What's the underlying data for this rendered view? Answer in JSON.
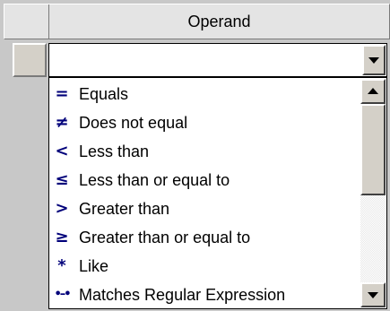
{
  "grid": {
    "column_header": "Operand"
  },
  "combo": {
    "value": ""
  },
  "dropdown": {
    "items": [
      {
        "icon": "=",
        "icon_name": "equals-icon",
        "label": "Equals"
      },
      {
        "icon": "≠",
        "icon_name": "not-equal-icon",
        "label": "Does not equal"
      },
      {
        "icon": "<",
        "icon_name": "less-than-icon",
        "label": "Less than"
      },
      {
        "icon": "≤",
        "icon_name": "less-than-or-equal-icon",
        "label": "Less than or equal to"
      },
      {
        "icon": ">",
        "icon_name": "greater-than-icon",
        "label": "Greater than"
      },
      {
        "icon": "≥",
        "icon_name": "greater-than-or-equal-icon",
        "label": "Greater than or equal to"
      },
      {
        "icon": "*",
        "icon_name": "asterisk-icon",
        "label": "Like"
      },
      {
        "icon": "•–•",
        "icon_name": "regex-icon",
        "label": "Matches Regular Expression"
      }
    ]
  },
  "colors": {
    "icon_color": "#00007a",
    "face": "#d4d0c8"
  }
}
